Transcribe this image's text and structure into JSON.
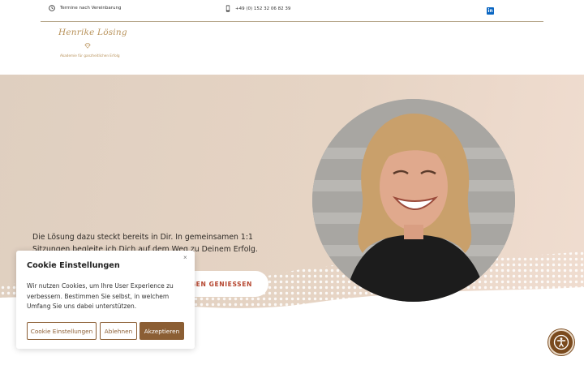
{
  "topbar": {
    "hours_text": "Termine nach Vereinbarung",
    "phone_text": "+49 (0) 152 32 06 82 39",
    "linkedin_label": "in"
  },
  "logo": {
    "script_text": "Henrike Lösing",
    "tagline": "Akademie für ganzheitlichen Erfolg"
  },
  "hero": {
    "text": "Die Lösung dazu steckt bereits in Dir. In gemeinsamen 1:1 Sitzungen begleite ich Dich auf dem Weg zu Deinem Erfolg.",
    "button_label": "ÜGEN GENIESSEN"
  },
  "cookie": {
    "title": "Cookie Einstellungen",
    "close_label": "×",
    "body": "Wir nutzen Cookies, um Ihre User Experience zu verbessern. Bestimmen Sie selbst, in welchem Umfang Sie uns dabei unterstützen.",
    "settings_label": "Cookie Einstellungen",
    "reject_label": "Ablehnen",
    "accept_label": "Akzeptieren"
  },
  "colors": {
    "accent_brown": "#8b5e34",
    "cta_text": "#b5462f",
    "logo_gold": "#b8925a",
    "hero_bg": "#e6d4c4"
  },
  "icons": [
    "clock-icon",
    "phone-icon",
    "linkedin-icon",
    "diamond-icon",
    "accessibility-icon",
    "close-icon"
  ]
}
